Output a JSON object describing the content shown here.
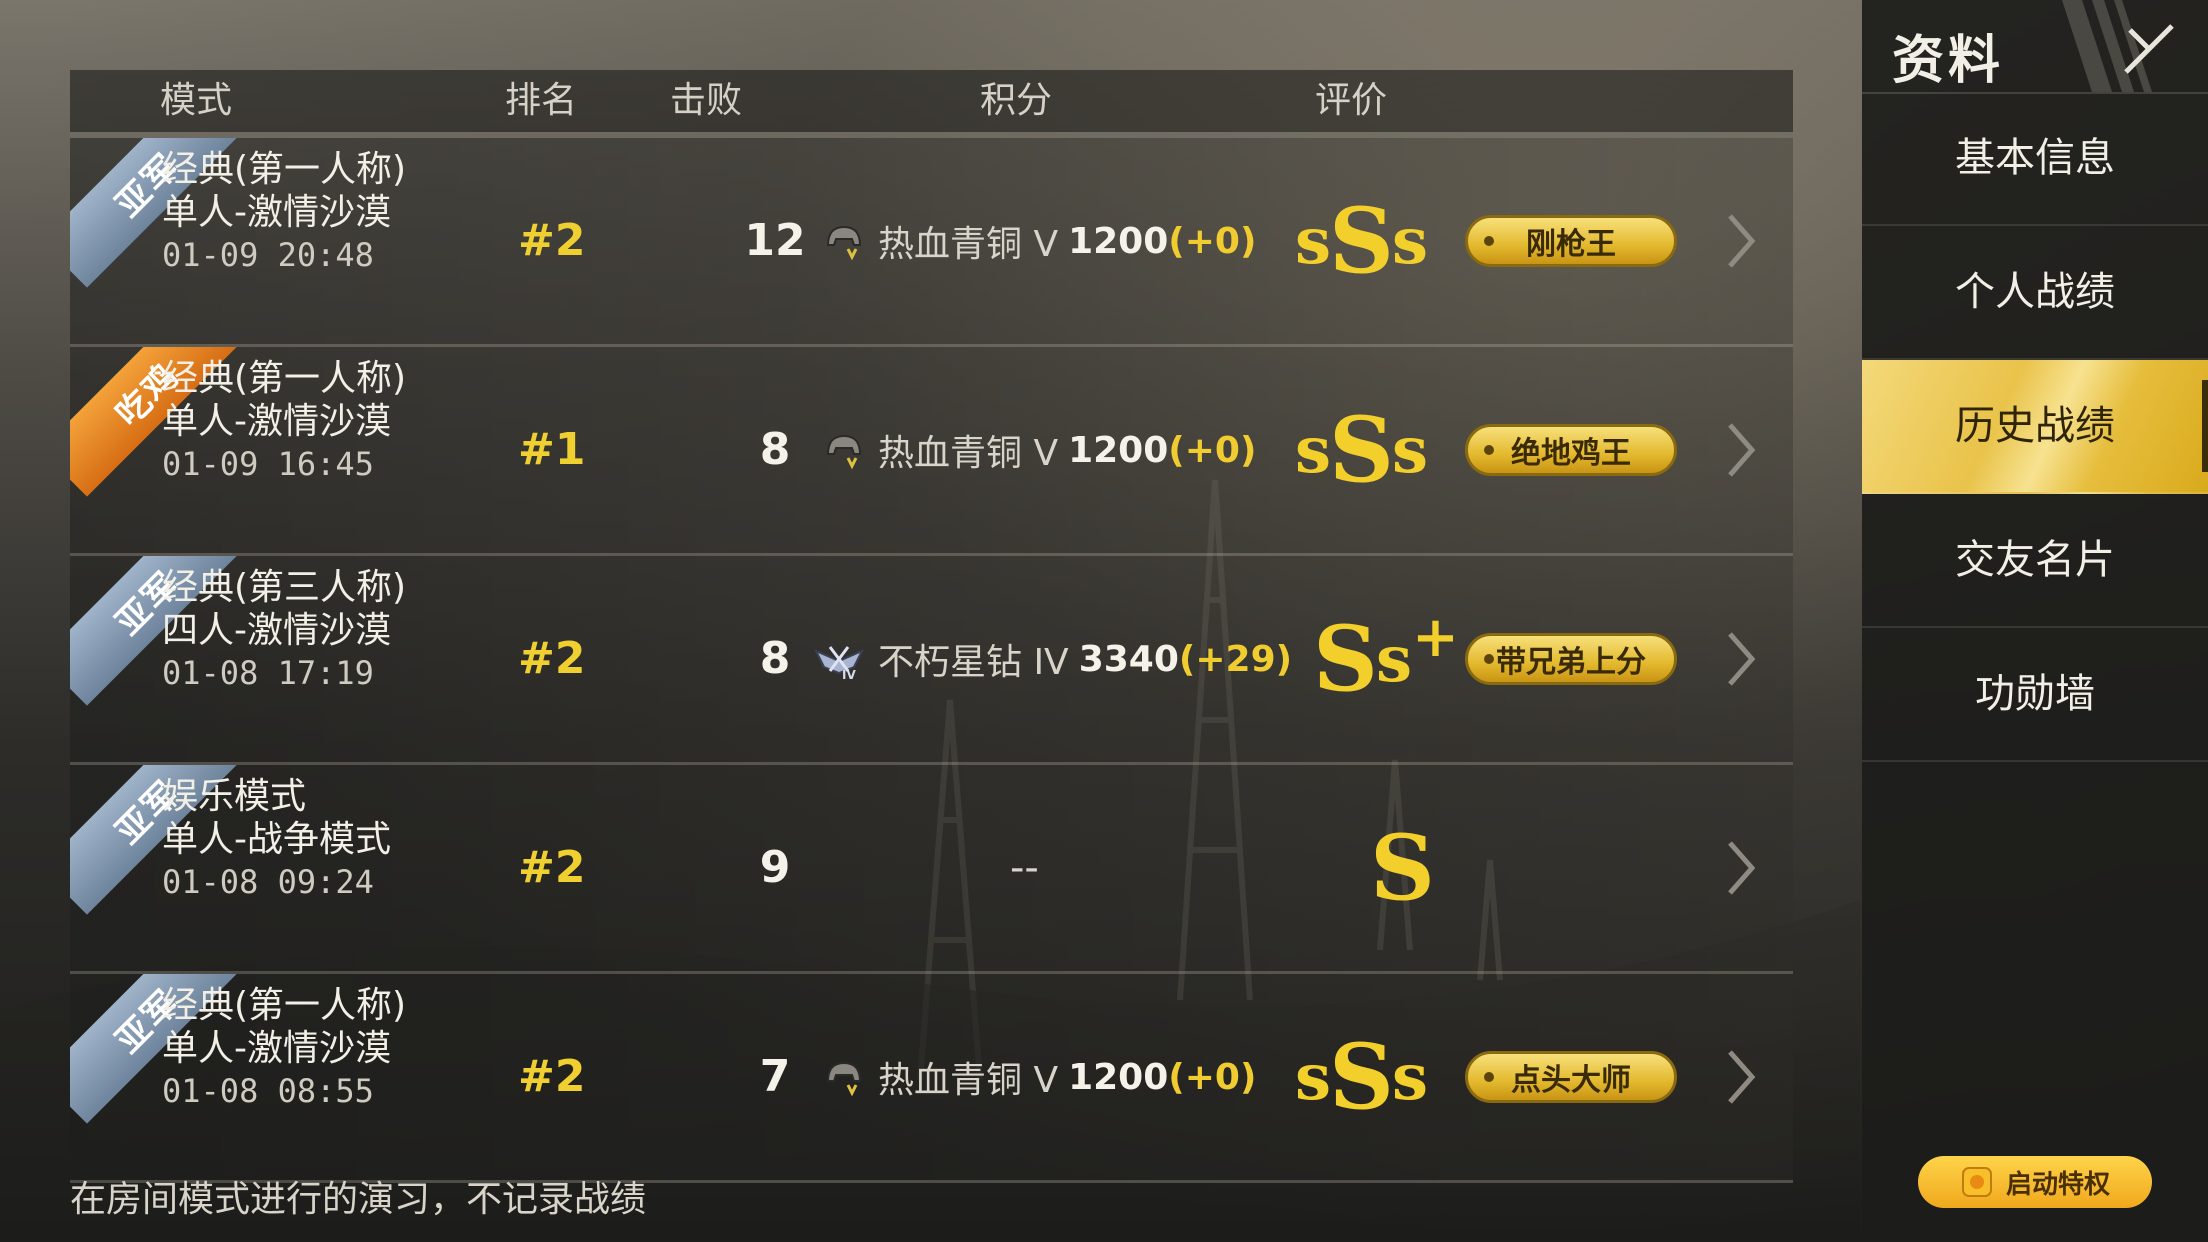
{
  "panel": {
    "title": "资料",
    "nav": [
      "基本信息",
      "个人战绩",
      "历史战绩",
      "交友名片",
      "功勋墙"
    ],
    "active": "历史战绩",
    "privilege_label": "启动特权"
  },
  "table": {
    "headers": {
      "mode": "模式",
      "rank": "排名",
      "kills": "击败",
      "score": "积分",
      "grade": "评价"
    },
    "rows": [
      {
        "ribbon": "亚军",
        "mode1": "经典(第一人称)",
        "mode2": "单人-激情沙漠",
        "time": "01-09 20:48",
        "rank": "#2",
        "kills": "12",
        "tier": "热血青铜 V",
        "points": "1200",
        "delta": "(+0)",
        "grade": "sSs",
        "badge": "刚枪王"
      },
      {
        "ribbon": "吃鸡",
        "mode1": "经典(第一人称)",
        "mode2": "单人-激情沙漠",
        "time": "01-09 16:45",
        "rank": "#1",
        "kills": "8",
        "tier": "热血青铜 V",
        "points": "1200",
        "delta": "(+0)",
        "grade": "sSs",
        "badge": "绝地鸡王"
      },
      {
        "ribbon": "亚军",
        "mode1": "经典(第三人称)",
        "mode2": "四人-激情沙漠",
        "time": "01-08 17:19",
        "rank": "#2",
        "kills": "8",
        "tier": "不朽星钻 IV",
        "points": "3340",
        "delta": "(+29)",
        "grade": "Ss+",
        "badge": "带兄弟上分"
      },
      {
        "ribbon": "亚军",
        "mode1": "娱乐模式",
        "mode2": "单人-战争模式",
        "time": "01-08 09:24",
        "rank": "#2",
        "kills": "9",
        "score_text": "--",
        "grade": "S"
      },
      {
        "ribbon": "亚军",
        "mode1": "经典(第一人称)",
        "mode2": "单人-激情沙漠",
        "time": "01-08 08:55",
        "rank": "#2",
        "kills": "7",
        "tier": "热血青铜 V",
        "points": "1200",
        "delta": "(+0)",
        "grade": "sSs",
        "badge": "点头大师"
      }
    ]
  },
  "footnote": "在房间模式进行的演习，不记录战绩",
  "colors": {
    "accent_gold": "#f0d030",
    "ribbon_silver": "#8aa0b8",
    "ribbon_gold": "#f09030",
    "panel_bg": "#1c1c1a"
  }
}
